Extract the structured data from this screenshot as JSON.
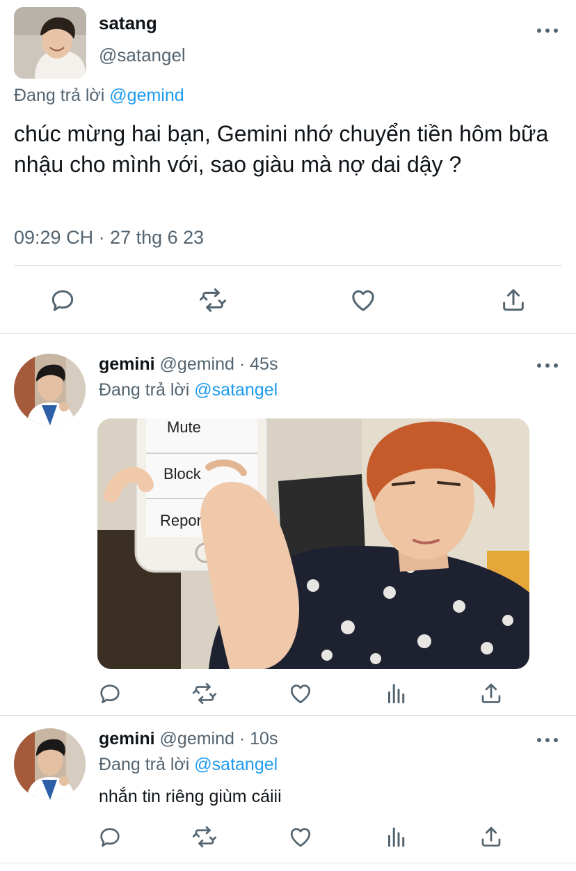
{
  "main_tweet": {
    "display_name": "satang",
    "handle": "@satangel",
    "replying_prefix": "Đang trả lời",
    "replying_to": "@gemind",
    "text": "chúc mừng hai bạn, Gemini nhớ chuyển tiền hôm bữa nhậu cho mình với, sao giàu mà nợ dai dậy ?",
    "timestamp": "09:29 CH · 27 thg 6 23",
    "actions": [
      "reply-icon",
      "retweet-icon",
      "like-icon",
      "share-icon"
    ]
  },
  "replies": [
    {
      "display_name": "gemini",
      "handle": "@gemind",
      "separator": "·",
      "time": "45s",
      "replying_prefix": "Đang trả lời",
      "replying_to": "@satangel",
      "media": {
        "menu_items": [
          "Mute",
          "Block",
          "Report"
        ]
      },
      "actions": [
        "reply-icon",
        "retweet-icon",
        "like-icon",
        "views-icon",
        "share-icon"
      ]
    },
    {
      "display_name": "gemini",
      "handle": "@gemind",
      "separator": "·",
      "time": "10s",
      "replying_prefix": "Đang trả lời",
      "replying_to": "@satangel",
      "text": "nhắn tin riêng giùm cáiii",
      "actions": [
        "reply-icon",
        "retweet-icon",
        "like-icon",
        "views-icon",
        "share-icon"
      ]
    }
  ],
  "colors": {
    "text": "#0f1419",
    "secondary": "#536471",
    "link": "#1d9bf0",
    "divider": "#d9dee2"
  }
}
